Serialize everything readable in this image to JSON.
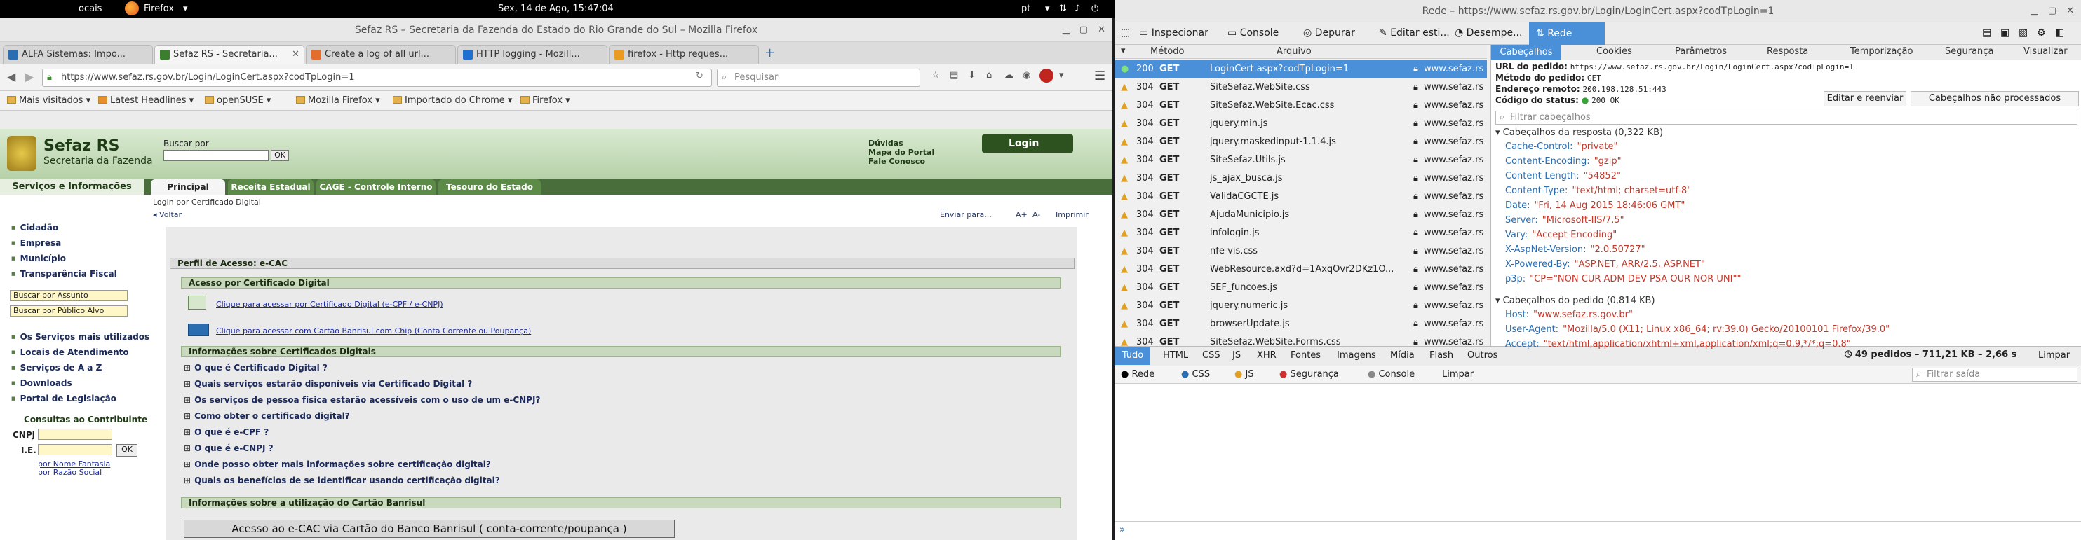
{
  "system": {
    "activities": "ocais",
    "firefox_menu": "Firefox",
    "clock": "Sex, 14 de Ago, 15:47:04",
    "lang": "pt"
  },
  "left_window": {
    "title": "Sefaz RS – Secretaria da Fazenda do Estado do Rio Grande do Sul – Mozilla Firefox",
    "tabs": [
      {
        "label": "ALFA Sistemas: Impo...",
        "color": "#2a6db0"
      },
      {
        "label": "Sefaz RS - Secretaria...",
        "color": "#3b7f2e"
      },
      {
        "label": "Create a log of all url...",
        "color": "#e26d2c"
      },
      {
        "label": "HTTP logging - Mozill...",
        "color": "#1f6fd1"
      },
      {
        "label": "firefox - Http reques...",
        "color": "#e99b22"
      }
    ],
    "url": "https://www.sefaz.rs.gov.br/Login/LoginCert.aspx?codTpLogin=1",
    "search_placeholder": "Pesquisar",
    "bookmarks": [
      "Mais visitados",
      "Latest Headlines",
      "openSUSE",
      "Mozilla Firefox",
      "Importado do Chrome",
      "Firefox"
    ],
    "page": {
      "logo_title": "Sefaz RS",
      "logo_sub": "Secretaria da Fazenda",
      "search_label": "Buscar por",
      "ok": "OK",
      "links": [
        "Dúvidas",
        "Mapa do Portal",
        "Fale Conosco"
      ],
      "login": "Login",
      "services_header": "Serviços e Informações",
      "top_tabs": [
        "Principal",
        "Receita Estadual",
        "CAGE - Controle Interno",
        "Tesouro do Estado"
      ],
      "breadcrumb": "Login por Certificado Digital",
      "voltar": "Voltar",
      "actions": [
        "Enviar para...",
        "A+",
        "A-",
        "Imprimir"
      ],
      "side_items": [
        "Cidadão",
        "Empresa",
        "Município",
        "Transparência Fiscal"
      ],
      "select1": "Buscar por Assunto",
      "select2": "Buscar por Público Alvo",
      "side_items2": [
        "Os Serviços mais utilizados",
        "Locais de Atendimento",
        "Serviços de A a Z",
        "Downloads",
        "Portal de Legislação"
      ],
      "consultas": "Consultas ao Contribuinte",
      "cnpj": "CNPJ",
      "ie": "I.E.",
      "por_nome": "por Nome Fantasia",
      "por_razao": "por Razão Social",
      "perfil": "Perfil de Acesso: e-CAC",
      "acesso_cert": "Acesso por Certificado Digital",
      "link_cert": "Clique para acessar por Certificado Digital (e-CPF / e-CNPJ)",
      "link_banri": "Clique para acessar com Cartão Banrisul com Chip (Conta Corrente ou Poupança)",
      "info_cert": "Informações sobre Certificados Digitais",
      "faqs": [
        "O que é Certificado Digital ?",
        "Quais serviços estarão disponíveis via Certificado Digital ?",
        "Os serviços de pessoa física estarão acessíveis com o uso de um e-CNPJ?",
        "Como obter o certificado digital?",
        "O que é e-CPF ?",
        "O que é e-CNPJ ?",
        "Onde posso obter mais informações sobre certificação digital?",
        "Quais os benefícios de se identificar usando certificação digital?"
      ],
      "info_banri": "Informações sobre a utilização do Cartão Banrisul",
      "banri_box": "Acesso ao e-CAC via Cartão do Banco Banrisul ( conta-corrente/poupança )"
    }
  },
  "devtools": {
    "title": "Rede – https://www.sefaz.rs.gov.br/Login/LoginCert.aspx?codTpLogin=1",
    "toolbar": [
      "Inspecionar",
      "Console",
      "Depurar",
      "Editar esti...",
      "Desempe...",
      "Rede"
    ],
    "columns": [
      "Método",
      "Arquivo"
    ],
    "requests": [
      {
        "st": "●",
        "code": "200",
        "method": "GET",
        "file": "LoginCert.aspx?codTpLogin=1",
        "domain": "www.sefaz.rs",
        "sel": true
      },
      {
        "st": "▲",
        "code": "304",
        "method": "GET",
        "file": "SiteSefaz.WebSite.css",
        "domain": "www.sefaz.rs"
      },
      {
        "st": "▲",
        "code": "304",
        "method": "GET",
        "file": "SiteSefaz.WebSite.Ecac.css",
        "domain": "www.sefaz.rs"
      },
      {
        "st": "▲",
        "code": "304",
        "method": "GET",
        "file": "jquery.min.js",
        "domain": "www.sefaz.rs"
      },
      {
        "st": "▲",
        "code": "304",
        "method": "GET",
        "file": "jquery.maskedinput-1.1.4.js",
        "domain": "www.sefaz.rs"
      },
      {
        "st": "▲",
        "code": "304",
        "method": "GET",
        "file": "SiteSefaz.Utils.js",
        "domain": "www.sefaz.rs"
      },
      {
        "st": "▲",
        "code": "304",
        "method": "GET",
        "file": "js_ajax_busca.js",
        "domain": "www.sefaz.rs"
      },
      {
        "st": "▲",
        "code": "304",
        "method": "GET",
        "file": "ValidaCGCTE.js",
        "domain": "www.sefaz.rs"
      },
      {
        "st": "▲",
        "code": "304",
        "method": "GET",
        "file": "AjudaMunicipio.js",
        "domain": "www.sefaz.rs"
      },
      {
        "st": "▲",
        "code": "304",
        "method": "GET",
        "file": "infologin.js",
        "domain": "www.sefaz.rs"
      },
      {
        "st": "▲",
        "code": "304",
        "method": "GET",
        "file": "nfe-vis.css",
        "domain": "www.sefaz.rs"
      },
      {
        "st": "▲",
        "code": "304",
        "method": "GET",
        "file": "WebResource.axd?d=1AxqOvr2DKz1O...",
        "domain": "www.sefaz.rs"
      },
      {
        "st": "▲",
        "code": "304",
        "method": "GET",
        "file": "SEF_funcoes.js",
        "domain": "www.sefaz.rs"
      },
      {
        "st": "▲",
        "code": "304",
        "method": "GET",
        "file": "jquery.numeric.js",
        "domain": "www.sefaz.rs"
      },
      {
        "st": "▲",
        "code": "304",
        "method": "GET",
        "file": "browserUpdate.js",
        "domain": "www.sefaz.rs"
      },
      {
        "st": "▲",
        "code": "304",
        "method": "GET",
        "file": "SiteSefaz.WebSite.Forms.css",
        "domain": "www.sefaz.rs"
      }
    ],
    "detail_tabs": [
      "Cabeçalhos",
      "Cookies",
      "Parâmetros",
      "Resposta",
      "Temporização",
      "Segurança",
      "Visualizar"
    ],
    "summary": [
      {
        "k": "URL do pedido:",
        "v": "https://www.sefaz.rs.gov.br/Login/LoginCert.aspx?codTpLogin=1"
      },
      {
        "k": "Método do pedido:",
        "v": "GET"
      },
      {
        "k": "Endereço remoto:",
        "v": "200.198.128.51:443"
      },
      {
        "k": "Código do status:",
        "v": "200 OK"
      }
    ],
    "edit_resend": "Editar e reenviar",
    "raw_headers": "Cabeçalhos não processados",
    "filter_headers": "Filtrar cabeçalhos",
    "response_section": "Cabeçalhos da resposta (0,322 KB)",
    "response_headers": [
      {
        "k": "Cache-Control:",
        "v": "\"private\""
      },
      {
        "k": "Content-Encoding:",
        "v": "\"gzip\""
      },
      {
        "k": "Content-Length:",
        "v": "\"54852\""
      },
      {
        "k": "Content-Type:",
        "v": "\"text/html; charset=utf-8\""
      },
      {
        "k": "Date:",
        "v": "\"Fri, 14 Aug 2015 18:46:06 GMT\""
      },
      {
        "k": "Server:",
        "v": "\"Microsoft-IIS/7.5\""
      },
      {
        "k": "Vary:",
        "v": "\"Accept-Encoding\""
      },
      {
        "k": "X-AspNet-Version:",
        "v": "\"2.0.50727\""
      },
      {
        "k": "X-Powered-By:",
        "v": "\"ASP.NET, ARR/2.5, ASP.NET\""
      },
      {
        "k": "p3p:",
        "v": "\"CP=\"NON CUR ADM DEV PSA OUR NOR UNI\"\""
      }
    ],
    "request_section": "Cabeçalhos do pedido (0,814 KB)",
    "request_headers": [
      {
        "k": "Host:",
        "v": "\"www.sefaz.rs.gov.br\""
      },
      {
        "k": "User-Agent:",
        "v": "\"Mozilla/5.0 (X11; Linux x86_64; rv:39.0) Gecko/20100101 Firefox/39.0\""
      },
      {
        "k": "Accept:",
        "v": "\"text/html,application/xhtml+xml,application/xml;q=0.9,*/*;q=0.8\""
      }
    ],
    "type_filters": [
      "Tudo",
      "HTML",
      "CSS",
      "JS",
      "XHR",
      "Fontes",
      "Imagens",
      "Mídia",
      "Flash",
      "Outros"
    ],
    "totals": "49 pedidos – 711,21 KB – 2,66 s",
    "limpar": "Limpar",
    "console_filters": [
      "Rede",
      "CSS",
      "JS",
      "Segurança",
      "Console"
    ],
    "limpar2": "Limpar",
    "filter_output": "Filtrar saída",
    "prompt": "»"
  }
}
